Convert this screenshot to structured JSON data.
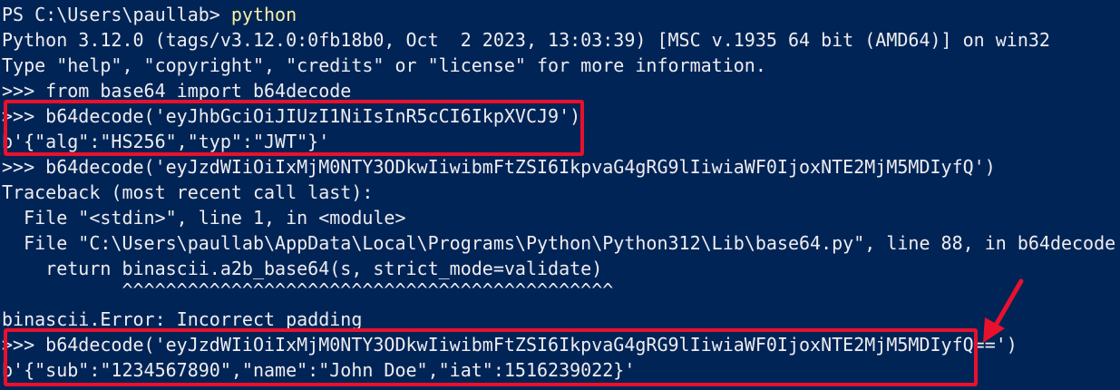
{
  "terminal": {
    "lines": {
      "l1_prompt": "PS C:\\Users\\paullab> ",
      "l1_cmd": "python",
      "l2": "Python 3.12.0 (tags/v3.12.0:0fb18b0, Oct  2 2023, 13:03:39) [MSC v.1935 64 bit (AMD64)] on win32",
      "l3": "Type \"help\", \"copyright\", \"credits\" or \"license\" for more information.",
      "l4": ">>> from base64 import b64decode",
      "l5": ">>> b64decode('eyJhbGciOiJIUzI1NiIsInR5cCI6IkpXVCJ9')",
      "l6": "b'{\"alg\":\"HS256\",\"typ\":\"JWT\"}'",
      "l7": ">>> b64decode('eyJzdWIiOiIxMjM0NTY3ODkwIiwibmFtZSI6IkpvaG4gRG9lIiwiaWF0IjoxNTE2MjM5MDIyfQ')",
      "l8": "Traceback (most recent call last):",
      "l9": "  File \"<stdin>\", line 1, in <module>",
      "l10": "  File \"C:\\Users\\paullab\\AppData\\Local\\Programs\\Python\\Python312\\Lib\\base64.py\", line 88, in b64decode",
      "l11": "    return binascii.a2b_base64(s, strict_mode=validate)",
      "l12": "           ^^^^^^^^^^^^^^^^^^^^^^^^^^^^^^^^^^^^^^^^^^^^^",
      "l13": "binascii.Error: Incorrect padding",
      "l14": ">>> b64decode('eyJzdWIiOiIxMjM0NTY3ODkwIiwibmFtZSI6IkpvaG4gRG9lIiwiaWF0IjoxNTE2MjM5MDIyfQ==')",
      "l15": "b'{\"sub\":\"1234567890\",\"name\":\"John Doe\",\"iat\":1516239022}'"
    }
  },
  "colors": {
    "background": "#012456",
    "text": "#eeedf0",
    "command": "#f9f1a5",
    "highlight": "#e8112d"
  }
}
